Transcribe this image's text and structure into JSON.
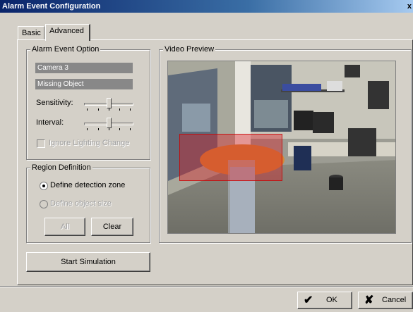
{
  "window": {
    "title": "Alarm Event Configuration",
    "close_glyph": "x"
  },
  "tabs": [
    {
      "label": "Basic"
    },
    {
      "label": "Advanced"
    }
  ],
  "alarm_option": {
    "legend": "Alarm Event Option",
    "camera": "Camera 3",
    "event": "Missing Object",
    "sensitivity_label": "Sensitivity:",
    "sensitivity_level": 0.5,
    "interval_label": "Interval:",
    "interval_level": 0.5,
    "ignore_lighting_label": "Ignore Lighting Change"
  },
  "region": {
    "legend": "Region Definition",
    "define_zone_label": "Define detection zone",
    "define_size_label": "Define object size",
    "all_button": "All",
    "clear_button": "Clear"
  },
  "start_simulation_button": "Start Simulation",
  "video": {
    "legend": "Video Preview"
  },
  "footer": {
    "ok_button": "OK",
    "cancel_button": "Cancel"
  },
  "colors": {
    "title_bar": "#0a246a",
    "zone_overlay": "#dc141e"
  }
}
